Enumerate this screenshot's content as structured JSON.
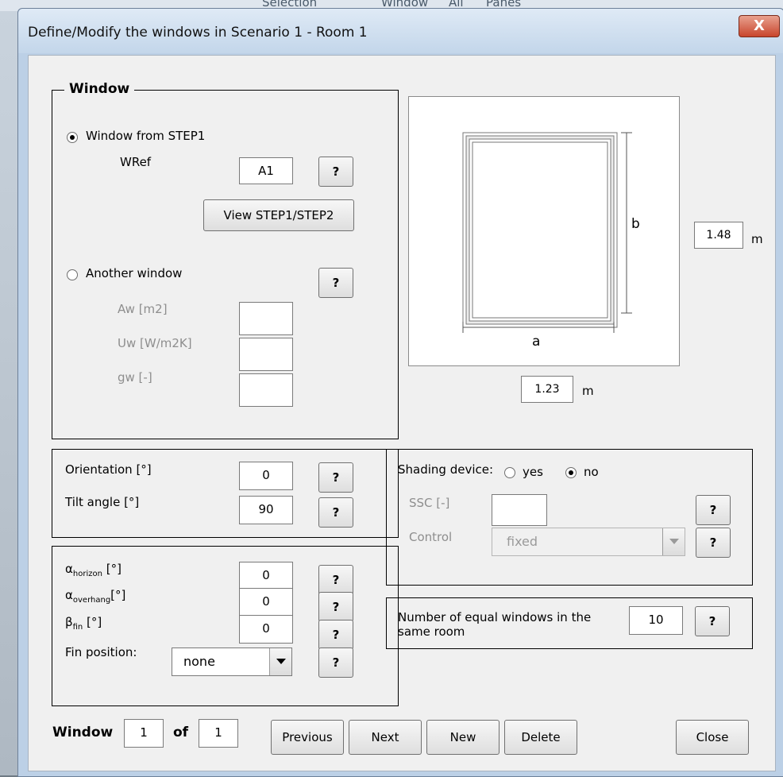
{
  "background": {
    "menu_selection": "Selection",
    "menu_window": "Window",
    "menu_all": "All",
    "menu_panes": "Panes"
  },
  "dialog": {
    "title": "Define/Modify the windows in Scenario 1 - Room 1",
    "close_glyph": "X"
  },
  "window_group": {
    "legend": "Window",
    "option_step1": "Window from STEP1",
    "wref_label": "WRef",
    "wref_value": "A1",
    "view_button": "View STEP1/STEP2",
    "option_another": "Another window",
    "aw_label": "Aw [m2]",
    "uw_label": "Uw [W/m2K]",
    "gw_label": "gw [-]",
    "aw_value": "",
    "uw_value": "",
    "gw_value": "",
    "selected": "step1"
  },
  "diagram": {
    "label_a": "a",
    "label_b": "b",
    "b_value": "1.48",
    "b_unit": "m",
    "a_value": "1.23",
    "a_unit": "m"
  },
  "orientation_group": {
    "orientation_label": "Orientation [°]",
    "orientation_value": "0",
    "tilt_label": "Tilt angle [°]",
    "tilt_value": "90"
  },
  "angles_group": {
    "alpha_symbol": "α",
    "beta_symbol": "β",
    "horizon_sub": "horizon",
    "overhang_sub": "overhang",
    "fin_sub": "fin",
    "unit": "[°]",
    "horizon_value": "0",
    "overhang_value": "0",
    "fin_value": "0",
    "fin_position_label": "Fin position:",
    "fin_position_value": "none"
  },
  "shading_group": {
    "label": "Shading device:",
    "yes_label": "yes",
    "no_label": "no",
    "selected": "no",
    "ssc_label": "SSC [-]",
    "ssc_value": "",
    "control_label": "Control",
    "control_value": "fixed"
  },
  "count_group": {
    "label_line1": "Number of equal windows in the",
    "label_line2": "same room",
    "value": "10"
  },
  "help_glyph": "?",
  "footer": {
    "window_label": "Window",
    "current": "1",
    "of_label": "of",
    "total": "1",
    "previous": "Previous",
    "next": "Next",
    "new": "New",
    "delete": "Delete",
    "close": "Close"
  }
}
